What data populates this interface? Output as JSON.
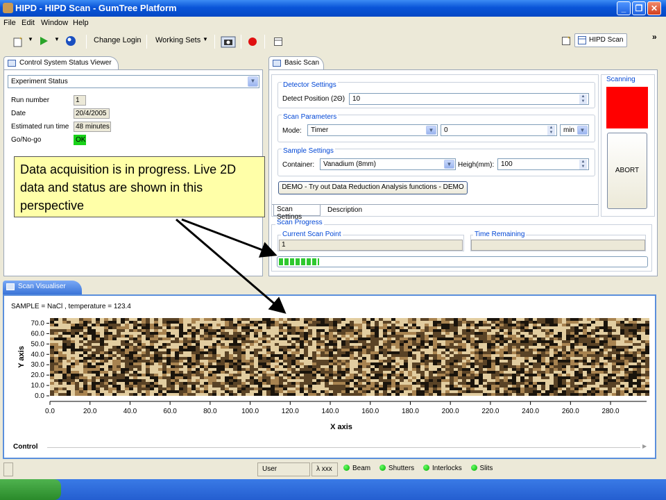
{
  "window": {
    "title": "HIPD - HIPD Scan - GumTree Platform",
    "controls": [
      "_",
      "❐",
      "✕"
    ]
  },
  "menu": [
    "File",
    "Edit",
    "Window",
    "Help"
  ],
  "toolbar": {
    "change_login": "Change Login",
    "working_sets": "Working Sets",
    "perspective": "HIPD Scan",
    "chevron": "»"
  },
  "status_viewer": {
    "tab": "Control System Status Viewer",
    "select": "Experiment Status",
    "rows": [
      {
        "label": "Run number",
        "value": "1"
      },
      {
        "label": "Date",
        "value": "20/4/2005"
      },
      {
        "label": "Estimated run time",
        "value": "48 minutes"
      },
      {
        "label": "Go/No-go",
        "value": "OK"
      }
    ]
  },
  "callout": {
    "text": "Data acquisition is in progress.  Live 2D data and status are shown in this perspective"
  },
  "basic_scan": {
    "tab": "Basic Scan",
    "detector": {
      "title": "Detector Settings",
      "label": "Detect Position (2Θ)",
      "value": "10"
    },
    "scan_params": {
      "title": "Scan Parameters",
      "mode_label": "Mode:",
      "mode_value": "Timer",
      "amount": "0",
      "unit": "min"
    },
    "sample": {
      "title": "Sample Settings",
      "container_label": "Container:",
      "container_value": "Vanadium (8mm)",
      "height_label": "Heigh(mm):",
      "height_value": "100"
    },
    "demo_button": "DEMO - Try out Data Reduction  Analysis functions - DEMO",
    "tabs": [
      "Scan Settings",
      "Description"
    ],
    "scanning": {
      "title": "Scanning",
      "abort": "ABORT",
      "indicator_color": "#ff0000"
    },
    "progress": {
      "title": "Scan Progress",
      "current_label": "Current Scan Point",
      "current_value": "1",
      "time_label": "Time Remaining",
      "time_value": "",
      "fraction": 0.11
    }
  },
  "visualiser": {
    "tab": "Scan Visualiser",
    "header": "SAMPLE = NaCl , temperature = 123.4",
    "control_label": "Control"
  },
  "chart_data": {
    "type": "heatmap",
    "title": "SAMPLE = NaCl , temperature = 123.4",
    "xlabel": "X axis",
    "ylabel": "Y axis",
    "xlim": [
      0,
      298
    ],
    "ylim": [
      0,
      75
    ],
    "x_ticks": [
      "0.0",
      "20.0",
      "40.0",
      "60.0",
      "80.0",
      "100.0",
      "120.0",
      "140.0",
      "160.0",
      "180.0",
      "200.0",
      "220.0",
      "240.0",
      "260.0",
      "280.0"
    ],
    "y_ticks": [
      "0.0",
      "10.0",
      "20.0",
      "30.0",
      "40.0",
      "50.0",
      "60.0",
      "70.0"
    ],
    "colormap": [
      "#1a140c",
      "#5a4326",
      "#a88350",
      "#e2cda0"
    ]
  },
  "statusbar": {
    "user": "User",
    "lambda": "λ xxx",
    "indicators": [
      "Beam",
      "Shutters",
      "Interlocks",
      "Slits"
    ]
  }
}
